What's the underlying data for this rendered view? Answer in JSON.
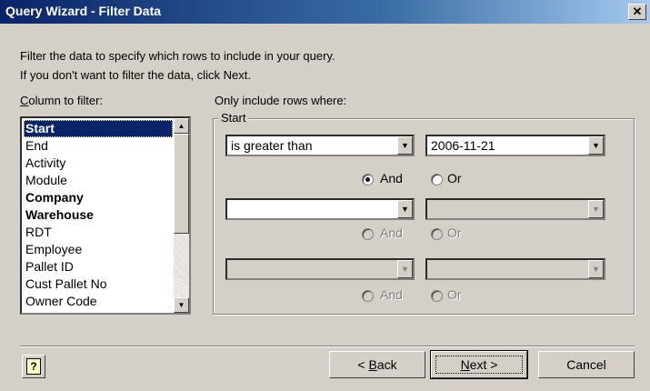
{
  "window": {
    "title": "Query Wizard - Filter Data",
    "close_glyph": "✕"
  },
  "instructions": {
    "line1": "Filter the data to specify which rows to include in your query.",
    "line2": "If you don't want to filter the data, click Next."
  },
  "column_label": "Column to filter:",
  "columns": [
    {
      "label": "Start",
      "bold": true,
      "selected": true
    },
    {
      "label": "End",
      "bold": false
    },
    {
      "label": "Activity",
      "bold": false
    },
    {
      "label": "Module",
      "bold": false
    },
    {
      "label": "Company",
      "bold": true
    },
    {
      "label": "Warehouse",
      "bold": true
    },
    {
      "label": "RDT",
      "bold": false
    },
    {
      "label": "Employee",
      "bold": false
    },
    {
      "label": "Pallet ID",
      "bold": false
    },
    {
      "label": "Cust Pallet No",
      "bold": false
    },
    {
      "label": "Owner Code",
      "bold": false
    }
  ],
  "criteria": {
    "label": "Only include rows where:",
    "group_title": "Start",
    "row1": {
      "operator": "is greater than",
      "value": "2006-11-21"
    },
    "row2": {
      "operator": "",
      "value": ""
    },
    "row3": {
      "operator": "",
      "value": ""
    },
    "and_label": "And",
    "or_label": "Or",
    "row1_choice": "And"
  },
  "buttons": {
    "back": "< Back",
    "next": "Next >",
    "cancel": "Cancel",
    "help": "?"
  }
}
